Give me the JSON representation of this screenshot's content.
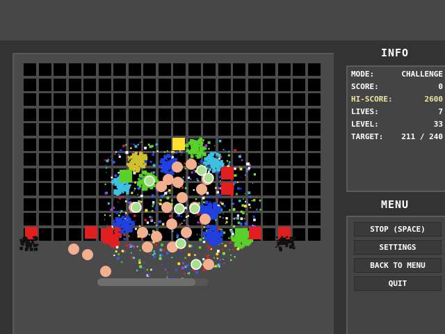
{
  "info": {
    "title": "INFO",
    "rows": [
      {
        "label": "MODE:",
        "value": "CHALLENGE"
      },
      {
        "label": "SCORE:",
        "value": "0"
      },
      {
        "label": "HI-SCORE:",
        "value": "2600"
      },
      {
        "label": "LIVES:",
        "value": "7"
      },
      {
        "label": "LEVEL:",
        "value": "33"
      },
      {
        "label": "TARGET:",
        "value": "211 / 240"
      }
    ]
  },
  "menu": {
    "title": "MENU",
    "buttons": [
      "STOP (SPACE)",
      "SETTINGS",
      "BACK TO MENU",
      "QUIT"
    ]
  },
  "board": {
    "columns": 20,
    "rows": 12
  },
  "progress": {
    "fraction": 0.88
  },
  "colors": {
    "background": "#333333",
    "grid_cell": "#000000",
    "hi_score": "#f2e4a0",
    "block_red": "#e02020",
    "block_green": "#5ad02a",
    "block_blue": "#2040e0",
    "ball_peach": "#f2b090"
  }
}
